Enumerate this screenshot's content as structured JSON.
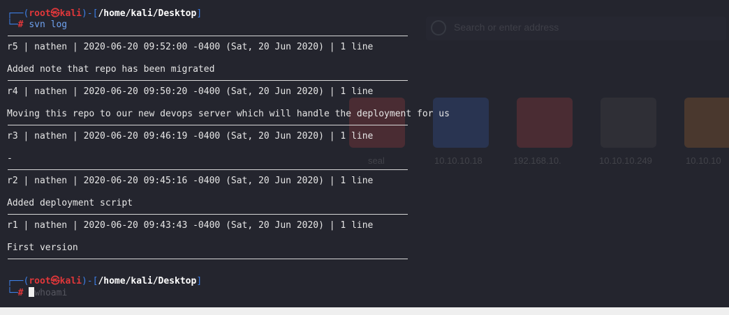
{
  "prompt": {
    "user": "root",
    "at": "㉿",
    "host": "kali",
    "path": "/home/kali/Desktop",
    "symbol": "#"
  },
  "command": "svn log",
  "log": [
    {
      "header": "r5 | nathen | 2020-06-20 09:52:00 -0400 (Sat, 20 Jun 2020) | 1 line",
      "message": "Added note that repo has been migrated"
    },
    {
      "header": "r4 | nathen | 2020-06-20 09:50:20 -0400 (Sat, 20 Jun 2020) | 1 line",
      "message": "Moving this repo to our new devops server which will handle the deployment for us"
    },
    {
      "header": "r3 | nathen | 2020-06-20 09:46:19 -0400 (Sat, 20 Jun 2020) | 1 line",
      "message": "-"
    },
    {
      "header": "r2 | nathen | 2020-06-20 09:45:16 -0400 (Sat, 20 Jun 2020) | 1 line",
      "message": "Added deployment script"
    },
    {
      "header": "r1 | nathen | 2020-06-20 09:43:43 -0400 (Sat, 20 Jun 2020) | 1 line",
      "message": "First version"
    }
  ],
  "background_browser": {
    "address_placeholder": "Search or enter address",
    "tiles": [
      "seal",
      "10.10.10.18",
      "192.168.10.",
      "10.10.10.249",
      "10.10.10"
    ]
  },
  "autosuggest_hint": "whoami",
  "colors": {
    "prompt_frame": "#3d7fe6",
    "user_host": "#e0373a",
    "path": "#ffffff",
    "command": "#6fa2ef",
    "background": "#24252e"
  }
}
